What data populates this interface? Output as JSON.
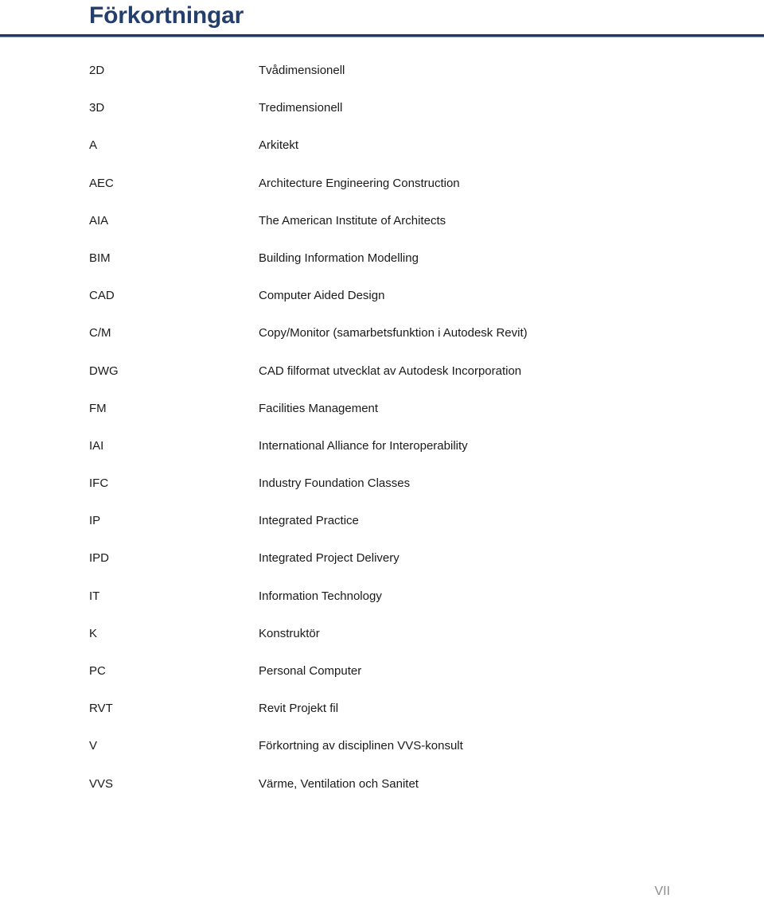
{
  "document": {
    "title": "Förkortningar",
    "accent_color": "#243f6b",
    "rule_color": "#23395f",
    "text_color": "#1a1a1a",
    "page_number": "VII"
  },
  "abbreviations": [
    {
      "term": "2D",
      "definition": "Tvådimensionell"
    },
    {
      "term": "3D",
      "definition": "Tredimensionell"
    },
    {
      "term": "A",
      "definition": "Arkitekt"
    },
    {
      "term": "AEC",
      "definition": "Architecture Engineering Construction"
    },
    {
      "term": "AIA",
      "definition": "The American Institute of Architects"
    },
    {
      "term": "BIM",
      "definition": "Building Information Modelling"
    },
    {
      "term": "CAD",
      "definition": "Computer Aided Design"
    },
    {
      "term": "C/M",
      "definition": "Copy/Monitor (samarbetsfunktion i Autodesk Revit)"
    },
    {
      "term": "DWG",
      "definition": "CAD filformat utvecklat av Autodesk Incorporation"
    },
    {
      "term": "FM",
      "definition": "Facilities Management"
    },
    {
      "term": "IAI",
      "definition": "International Alliance for Interoperability"
    },
    {
      "term": "IFC",
      "definition": "Industry Foundation Classes"
    },
    {
      "term": "IP",
      "definition": "Integrated Practice"
    },
    {
      "term": "IPD",
      "definition": "Integrated Project Delivery"
    },
    {
      "term": "IT",
      "definition": "Information Technology"
    },
    {
      "term": "K",
      "definition": "Konstruktör"
    },
    {
      "term": "PC",
      "definition": "Personal Computer"
    },
    {
      "term": "RVT",
      "definition": "Revit Projekt fil"
    },
    {
      "term": "V",
      "definition": "Förkortning av disciplinen VVS-konsult"
    },
    {
      "term": "VVS",
      "definition": "Värme, Ventilation och Sanitet"
    }
  ]
}
